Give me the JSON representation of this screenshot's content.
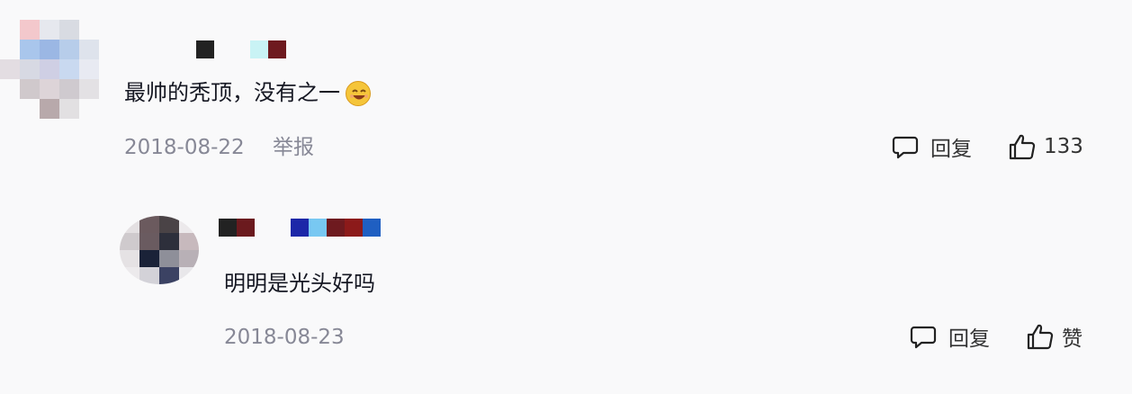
{
  "comments": [
    {
      "text": "最帅的秃顶，没有之一",
      "emoji": "smiling-face-emoji",
      "date": "2018-08-22",
      "report_label": "举报",
      "reply_label": "回复",
      "like_count": "133"
    },
    {
      "text": "明明是光头好吗",
      "date": "2018-08-23",
      "reply_label": "回复",
      "like_label": "赞"
    }
  ],
  "colors": {
    "text": "#161823",
    "meta": "#878896",
    "background": "#f9f9fa"
  },
  "icons": [
    "comment-bubble-icon",
    "thumbs-up-icon"
  ]
}
